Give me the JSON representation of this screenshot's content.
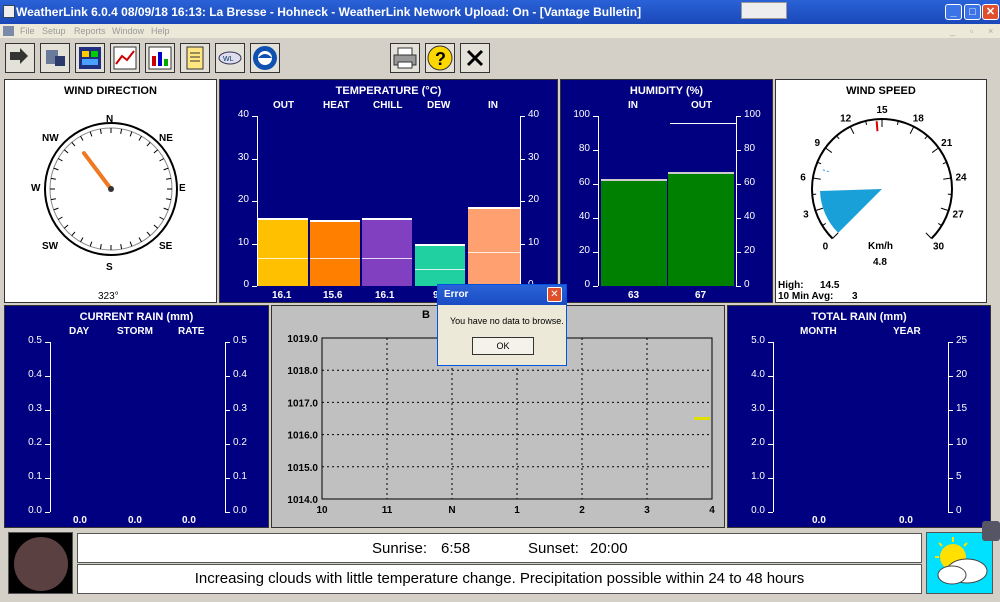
{
  "window": {
    "title": "WeatherLink 6.0.4  08/09/18  16:13: La Bresse - Hohneck - WeatherLink Network Upload: On - [Vantage Bulletin]",
    "minimize": "_",
    "maximize": "□",
    "close": "✕"
  },
  "menu": [
    "File",
    "Setup",
    "Reports",
    "Window",
    "Help"
  ],
  "wind_direction": {
    "title": "WIND DIRECTION",
    "points": [
      "N",
      "NE",
      "E",
      "SE",
      "S",
      "SW",
      "W",
      "NW"
    ],
    "degrees_label": "323°",
    "degrees": 323
  },
  "temperature": {
    "title": "TEMPERATURE  (°C)",
    "columns": [
      "OUT",
      "HEAT",
      "CHILL",
      "DEW",
      "IN"
    ],
    "ticks": [
      "40",
      "30",
      "20",
      "10",
      "0"
    ],
    "values_label": [
      "16.1",
      "15.6",
      "16.1",
      "9",
      ""
    ],
    "colors": [
      "#ffc000",
      "#ff8000",
      "#8040c0",
      "#20d0a0",
      "#ffa070"
    ]
  },
  "chart_data": [
    {
      "type": "bar",
      "title": "TEMPERATURE  (°C)",
      "categories": [
        "OUT",
        "HEAT",
        "CHILL",
        "DEW",
        "IN"
      ],
      "values": [
        16.1,
        15.6,
        16.1,
        9.9,
        18.5
      ],
      "ylim": [
        0,
        40
      ]
    },
    {
      "type": "bar",
      "title": "HUMIDITY  (%)",
      "categories": [
        "IN",
        "OUT"
      ],
      "values": [
        63,
        67
      ],
      "ylim": [
        0,
        100
      ]
    },
    {
      "type": "line",
      "x": [
        "10",
        "11",
        "N",
        "1",
        "2",
        "3",
        "4"
      ],
      "ylim": [
        1014.0,
        1019.0
      ],
      "series": [
        {
          "values": [
            1016.5
          ]
        }
      ]
    }
  ],
  "humidity": {
    "title": "HUMIDITY  (%)",
    "columns": [
      "IN",
      "OUT"
    ],
    "ticks": [
      "100",
      "80",
      "60",
      "40",
      "20",
      "0"
    ],
    "values_label": [
      "63",
      "67"
    ]
  },
  "wind_speed": {
    "title": "WIND SPEED",
    "ticks": [
      "0",
      "3",
      "6",
      "9",
      "12",
      "15",
      "18",
      "21",
      "24",
      "27",
      "30"
    ],
    "unit": "Km/h",
    "value": "4.8",
    "high_label": "High:",
    "high_value": "14.5",
    "avg_label": "10 Min Avg:",
    "avg_value": "3"
  },
  "current_rain": {
    "title": "CURRENT RAIN  (mm)",
    "columns": [
      "DAY",
      "STORM",
      "RATE"
    ],
    "ticks": [
      "0.5",
      "0.4",
      "0.3",
      "0.2",
      "0.1",
      "0.0"
    ],
    "values": [
      "0.0",
      "0.0",
      "0.0"
    ]
  },
  "barometer": {
    "title": "B",
    "y_ticks": [
      "1019.0",
      "1018.0",
      "1017.0",
      "1016.0",
      "1015.0",
      "1014.0"
    ],
    "x_ticks": [
      "10",
      "11",
      "N",
      "1",
      "2",
      "3",
      "4"
    ]
  },
  "total_rain": {
    "title": "TOTAL RAIN  (mm)",
    "columns": [
      "MONTH",
      "YEAR"
    ],
    "left_ticks": [
      "5.0",
      "4.0",
      "3.0",
      "2.0",
      "1.0",
      "0.0"
    ],
    "right_ticks": [
      "25",
      "20",
      "15",
      "10",
      "5",
      "0"
    ],
    "values": [
      "0.0",
      "0.0"
    ]
  },
  "sun": {
    "sunrise_label": "Sunrise:",
    "sunrise": "6:58",
    "sunset_label": "Sunset:",
    "sunset": "20:00"
  },
  "forecast": "Increasing clouds with little temperature change.  Precipitation possible within 24 to 48 hours",
  "error_dialog": {
    "title": "Error",
    "message": "You have no data to browse.",
    "ok": "OK"
  },
  "colors": {
    "panel_bg": "#000080",
    "humidity_bar": "#008000",
    "wind_sector": "#1aa0d8",
    "titlebar": "#2a62d8"
  }
}
